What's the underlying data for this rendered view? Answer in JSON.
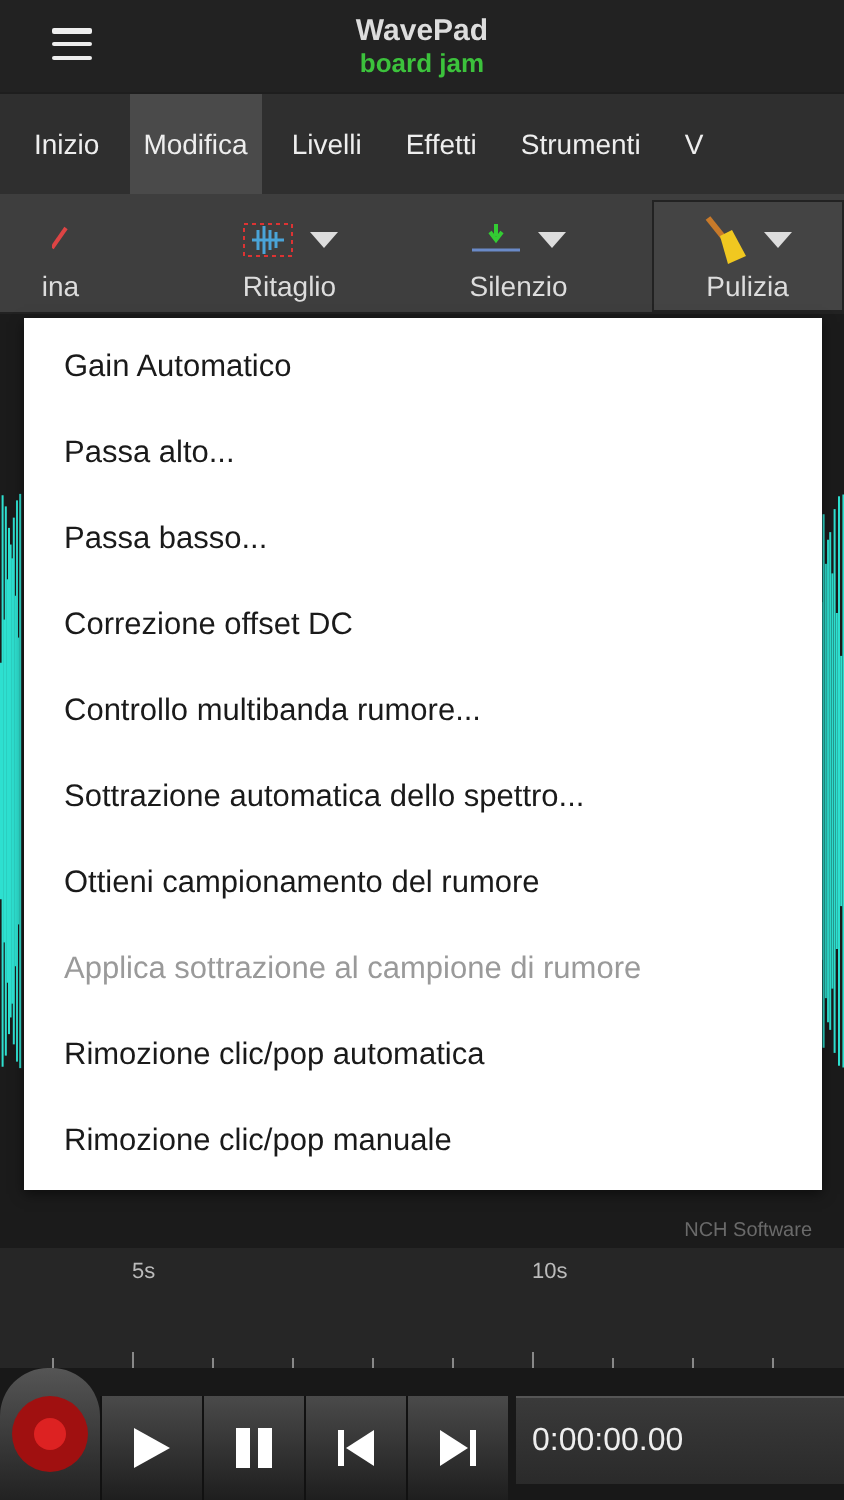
{
  "header": {
    "title": "WavePad",
    "subtitle": "board jam"
  },
  "tabs": [
    {
      "label": "Inizio",
      "selected": false
    },
    {
      "label": "Modifica",
      "selected": true
    },
    {
      "label": "Livelli",
      "selected": false
    },
    {
      "label": "Effetti",
      "selected": false
    },
    {
      "label": "Strumenti",
      "selected": false
    },
    {
      "label": "V",
      "selected": false
    }
  ],
  "toolbar": [
    {
      "label": "ina",
      "kind": "cut",
      "selected": false
    },
    {
      "label": "Ritaglio",
      "kind": "trim",
      "selected": false
    },
    {
      "label": "Silenzio",
      "kind": "silence",
      "selected": false
    },
    {
      "label": "Pulizia",
      "kind": "broom",
      "selected": true
    }
  ],
  "menu": [
    {
      "label": "Gain Automatico",
      "disabled": false
    },
    {
      "label": "Passa alto...",
      "disabled": false
    },
    {
      "label": "Passa basso...",
      "disabled": false
    },
    {
      "label": "Correzione offset DC",
      "disabled": false
    },
    {
      "label": "Controllo multibanda rumore...",
      "disabled": false
    },
    {
      "label": "Sottrazione automatica dello spettro...",
      "disabled": false
    },
    {
      "label": "Ottieni campionamento del rumore",
      "disabled": false
    },
    {
      "label": "Applica sottrazione al campione di rumore",
      "disabled": true
    },
    {
      "label": "Rimozione clic/pop automatica",
      "disabled": false
    },
    {
      "label": "Rimozione clic/pop manuale",
      "disabled": false
    }
  ],
  "watermark_text": "NCH Software",
  "timeline": [
    "5s",
    "10s"
  ],
  "transport": {
    "time": "0:00:00.00"
  }
}
